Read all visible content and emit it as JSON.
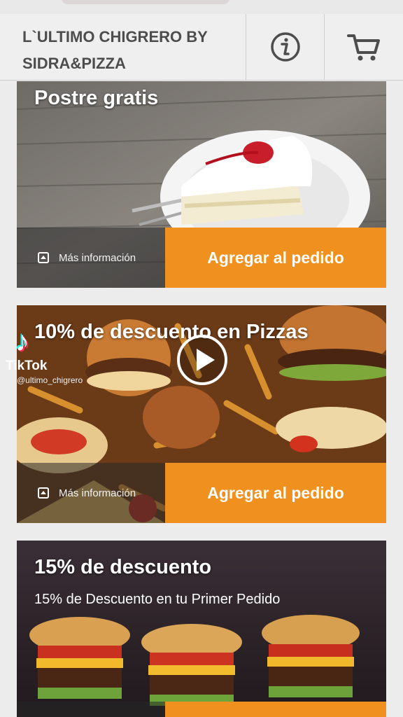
{
  "header": {
    "title_line1": "L`ULTIMO CHIGRERO BY",
    "title_line2": "SIDRA&PIZZA",
    "info_icon": "info-icon",
    "cart_icon": "cart-icon"
  },
  "cards": [
    {
      "title": "Postre gratis",
      "more_info": "Más información",
      "add_label": "Agregar al pedido"
    },
    {
      "title": "10% de descuento en Pizzas",
      "more_info": "Más información",
      "add_label": "Agregar al pedido"
    },
    {
      "title": "15% de descuento",
      "subtitle": "15% de Descuento en tu Primer Pedido"
    }
  ],
  "overlay": {
    "tiktok_brand": "TikTok",
    "tiktok_handle": "@ultimo_chigrero"
  },
  "colors": {
    "accent": "#f0901e",
    "header_bg": "#efefef",
    "title_text": "#4d4d4d"
  }
}
